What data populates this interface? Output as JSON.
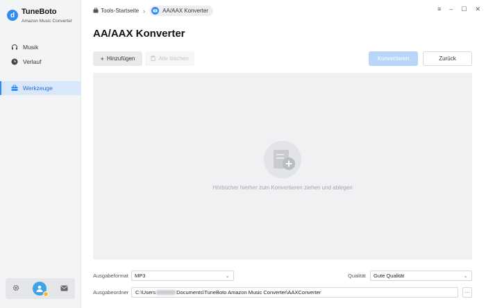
{
  "app": {
    "name": "TuneBoto",
    "subtitle": "Amazon Music Converter",
    "logo_letter": "d",
    "accent": "#2f8cf0"
  },
  "sidebar": {
    "items": [
      {
        "label": "Musik",
        "icon": "headphones-icon"
      },
      {
        "label": "Verlauf",
        "icon": "clock-icon"
      },
      {
        "label": "Werkzeuge",
        "icon": "toolbox-icon",
        "active": true
      }
    ],
    "bottom": [
      "gear-icon",
      "avatar",
      "mail-icon"
    ]
  },
  "breadcrumb": {
    "home": "Tools-Startseite",
    "separator": "›",
    "current": "AA/AAX Konverter"
  },
  "window_controls": {
    "menu": "≡",
    "minimize": "–",
    "maximize": "☐",
    "close": "✕"
  },
  "page": {
    "title": "AA/AAX Konverter"
  },
  "toolbar": {
    "add_label": "Hinzufügen",
    "delete_label": "Alle löschen",
    "convert_label": "Konvertieren",
    "back_label": "Zurück"
  },
  "drop_zone": {
    "hint": "Hörbücher hierher zum Konvertieren ziehen und ablegen"
  },
  "settings": {
    "format_label": "Ausgabeformat",
    "format_value": "MP3",
    "quality_label": "Qualität",
    "quality_value": "Gute Qualität",
    "folder_label": "Ausgabeordner",
    "folder_prefix": "C:\\Users",
    "folder_suffix": "Documents\\TuneBoto Amazon Music Converter\\AAXConverter",
    "more_label": "···"
  }
}
